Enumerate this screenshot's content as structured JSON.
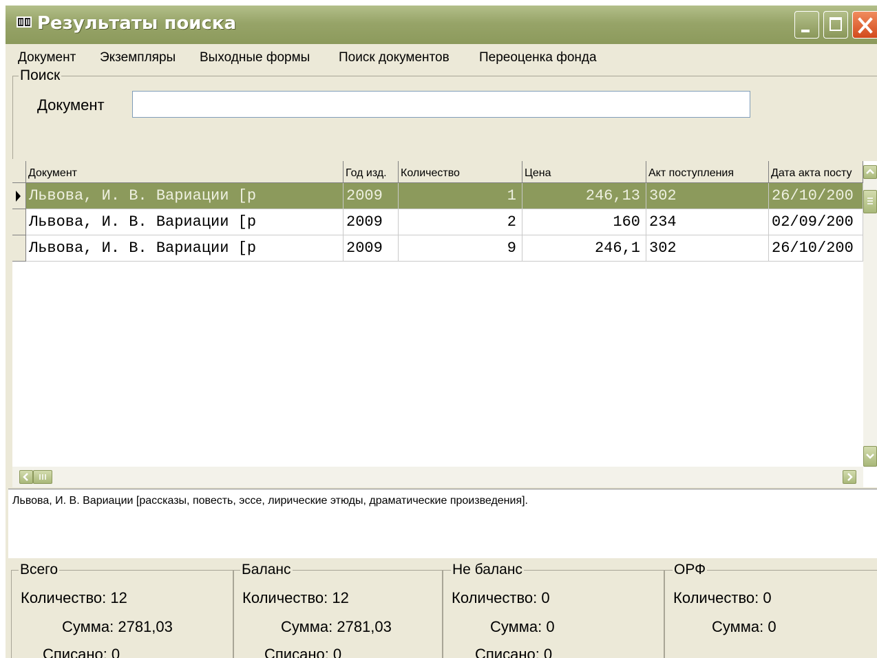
{
  "window": {
    "title": "Результаты поиска"
  },
  "menu": [
    "Документ",
    "Экземпляры",
    "Выходные формы",
    "Поиск документов",
    "Переоценка фонда"
  ],
  "search": {
    "group_label": "Поиск",
    "doc_label": "Документ",
    "doc_value": ""
  },
  "grid": {
    "columns": [
      "Документ",
      "Год изд.",
      "Количество",
      "Цена",
      "Акт поступления",
      "Дата акта посту"
    ],
    "rows": [
      [
        "Львова, И. В. Вариации  [р",
        "2009",
        "1",
        "246,13",
        "302",
        "26/10/200"
      ],
      [
        "Львова, И. В. Вариации  [р",
        "2009",
        "2",
        "160",
        "234",
        "02/09/200"
      ],
      [
        "Львова, И. В. Вариации  [р",
        "2009",
        "9",
        "246,1",
        "302",
        "26/10/200"
      ]
    ],
    "selected_row": 0
  },
  "description": "Львова, И. В. Вариации  [рассказы, повесть, эссе, лирические этюды, драматические произведения].",
  "summary": [
    {
      "label": "Всего",
      "count": "Количество: 12",
      "sum": "Сумма: 2781,03",
      "written_off": "Списано: 0"
    },
    {
      "label": "Баланс",
      "count": "Количество: 12",
      "sum": "Сумма: 2781,03",
      "written_off": "Списано: 0"
    },
    {
      "label": "Не баланс",
      "count": "Количество: 0",
      "sum": "Сумма: 0",
      "written_off": "Списано: 0"
    },
    {
      "label": "ОРФ",
      "count": "Количество: 0",
      "sum": "Сумма: 0"
    }
  ],
  "colors": {
    "titlebar": "#97a468",
    "selection": "#8c9a5c",
    "face": "#ECE9D8"
  }
}
